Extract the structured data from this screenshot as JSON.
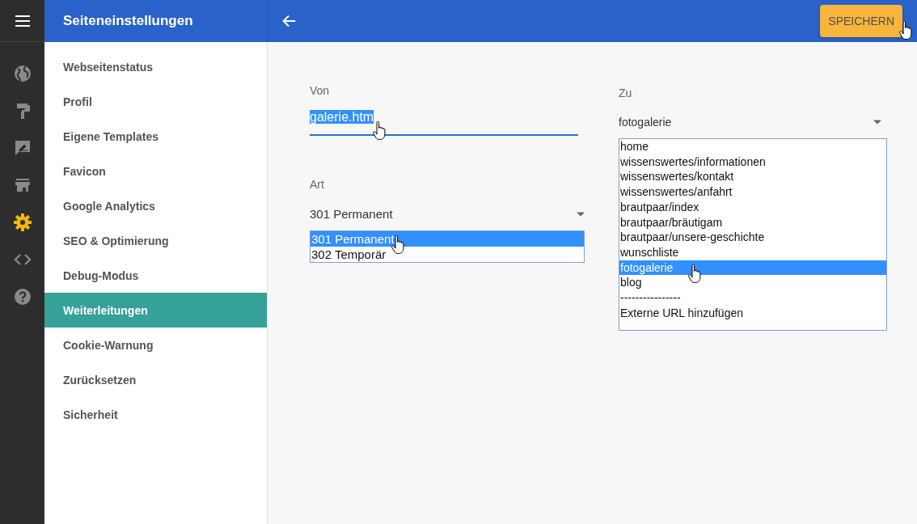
{
  "header": {
    "title": "Seiteneinstellungen",
    "save_button": {
      "label": "SPEICHERN",
      "hovered": true
    }
  },
  "rail": [
    {
      "kind": "globe",
      "selected": false
    },
    {
      "kind": "paint-roller",
      "selected": false
    },
    {
      "kind": "edit",
      "selected": false
    },
    {
      "kind": "store",
      "selected": false
    },
    {
      "kind": "gear",
      "selected": true
    },
    {
      "kind": "code",
      "selected": false
    },
    {
      "kind": "help",
      "selected": false
    }
  ],
  "sidebar": {
    "items": [
      {
        "label": "Webseitenstatus",
        "selected": false
      },
      {
        "label": "Profil",
        "selected": false
      },
      {
        "label": "Eigene Templates",
        "selected": false
      },
      {
        "label": "Favicon",
        "selected": false
      },
      {
        "label": "Google Analytics",
        "selected": false
      },
      {
        "label": "SEO & Optimierung",
        "selected": false
      },
      {
        "label": "Debug-Modus",
        "selected": false
      },
      {
        "label": "Weiterleitungen",
        "selected": true
      },
      {
        "label": "Cookie-Warnung",
        "selected": false
      },
      {
        "label": "Zurücksetzen",
        "selected": false
      },
      {
        "label": "Sicherheit",
        "selected": false
      }
    ]
  },
  "from": {
    "label": "Von",
    "value": "galerie.htm",
    "text_selected": true
  },
  "type": {
    "label": "Art",
    "value": "301 Permanent",
    "options": [
      {
        "label": "301 Permanent",
        "selected": true
      },
      {
        "label": "302 Temporär",
        "selected": false
      }
    ]
  },
  "to": {
    "label": "Zu",
    "value": "fotogalerie",
    "options": [
      {
        "label": "home",
        "selected": false
      },
      {
        "label": "wissenswertes/informationen",
        "selected": false
      },
      {
        "label": "wissenswertes/kontakt",
        "selected": false
      },
      {
        "label": "wissenswertes/anfahrt",
        "selected": false
      },
      {
        "label": "brautpaar/index",
        "selected": false
      },
      {
        "label": "brautpaar/bräutigam",
        "selected": false
      },
      {
        "label": "brautpaar/unsere-geschichte",
        "selected": false
      },
      {
        "label": "wunschliste",
        "selected": false
      },
      {
        "label": "fotogalerie",
        "selected": true
      },
      {
        "label": "blog",
        "selected": false
      },
      {
        "label": "----------------",
        "selected": false
      },
      {
        "label": "Externe URL hinzufügen",
        "selected": false
      }
    ]
  }
}
